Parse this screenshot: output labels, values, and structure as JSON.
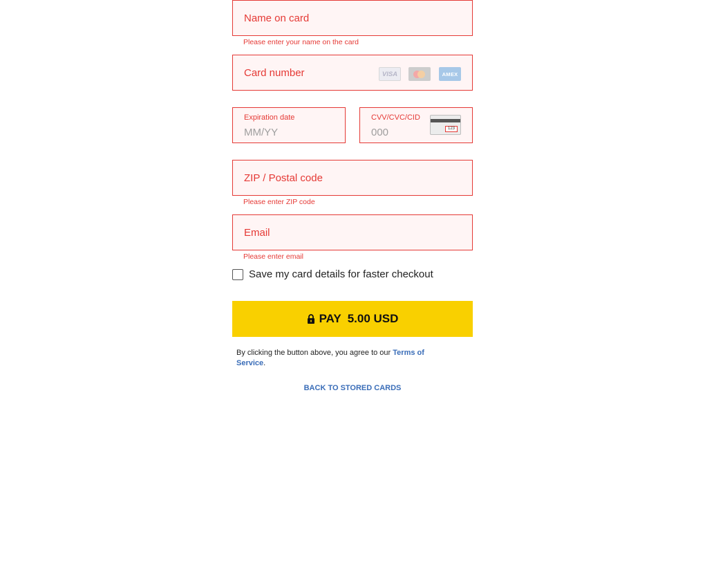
{
  "fields": {
    "name": {
      "placeholder": "Name on card",
      "error": "Please enter your name on the card"
    },
    "card_number": {
      "placeholder": "Card number",
      "brands": [
        {
          "name": "VISA",
          "icon": "visa-icon"
        },
        {
          "name": "mastercard",
          "icon": "mastercard-icon"
        },
        {
          "name": "AMEX",
          "icon": "amex-icon"
        }
      ]
    },
    "expiration": {
      "label": "Expiration date",
      "placeholder": "MM/YY"
    },
    "cvv": {
      "label": "CVV/CVC/CID",
      "placeholder": "000",
      "card_digits": "123"
    },
    "zip": {
      "placeholder": "ZIP / Postal code",
      "error": "Please enter ZIP code"
    },
    "email": {
      "placeholder": "Email",
      "error": "Please enter email"
    }
  },
  "save_card": {
    "label": "Save my card details for faster checkout",
    "checked": false
  },
  "pay_button": {
    "label": "PAY",
    "amount": "5.00 USD",
    "icon": "lock-icon"
  },
  "terms": {
    "prefix": "By clicking the button above, you agree to our ",
    "link_text": "Terms of Service",
    "suffix": "."
  },
  "back_link": "BACK TO STORED CARDS",
  "colors": {
    "error": "#e53935",
    "field_bg": "#fff5f5",
    "pay_button": "#f9d000",
    "link": "#3a6db8"
  }
}
